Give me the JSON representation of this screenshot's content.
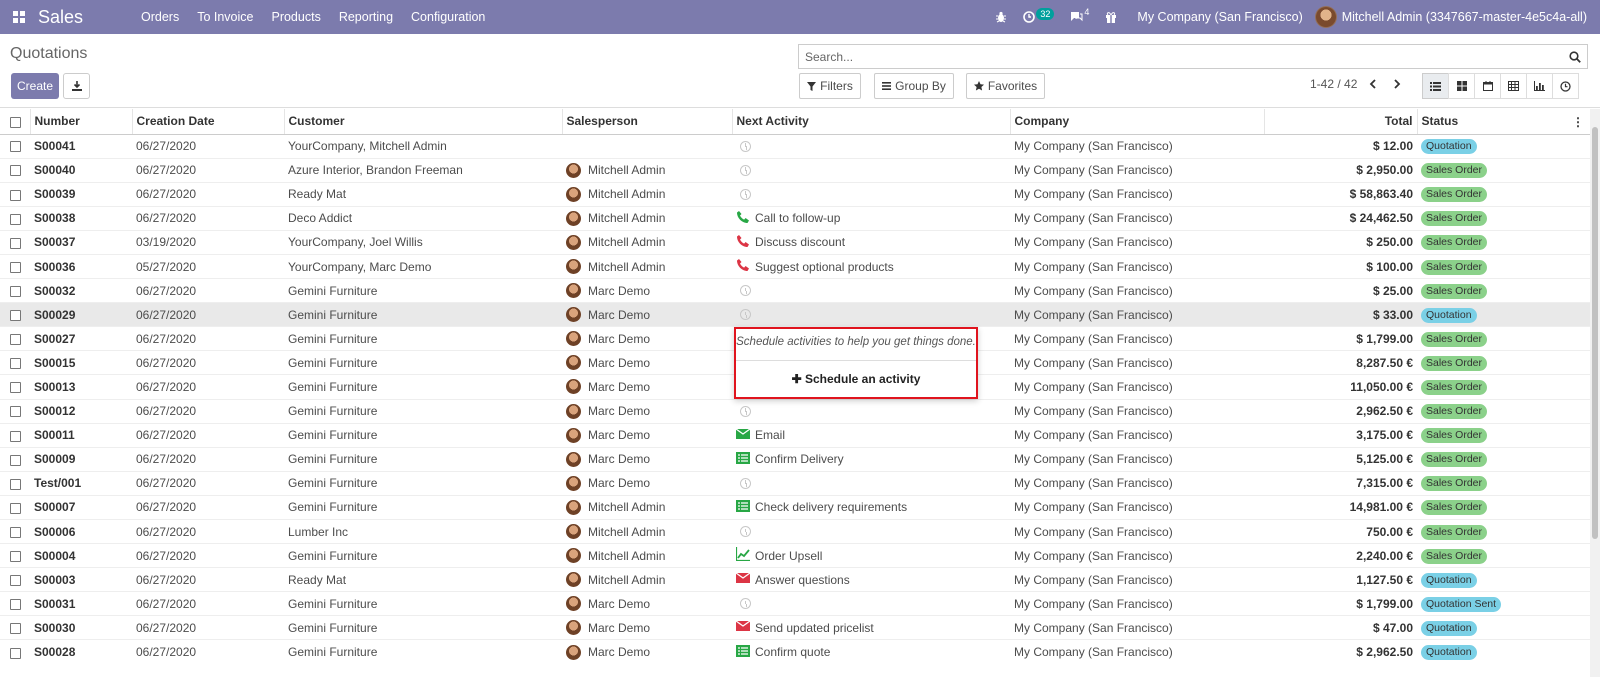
{
  "navbar": {
    "app_name": "Sales",
    "menu": [
      "Orders",
      "To Invoice",
      "Products",
      "Reporting",
      "Configuration"
    ],
    "activity_count": "32",
    "message_count": "4",
    "company": "My Company (San Francisco)",
    "user": "Mitchell Admin (3347667-master-4e5c4a-all)"
  },
  "control_panel": {
    "breadcrumb": "Quotations",
    "create_label": "Create",
    "search_placeholder": "Search...",
    "filters_label": "Filters",
    "group_by_label": "Group By",
    "favorites_label": "Favorites",
    "pager": "1-42 / 42",
    "views": [
      "list-icon",
      "kanban-icon",
      "calendar-icon",
      "pivot-icon",
      "graph-icon",
      "activity-icon"
    ]
  },
  "table": {
    "columns": [
      "Number",
      "Creation Date",
      "Customer",
      "Salesperson",
      "Next Activity",
      "Company",
      "Total",
      "Status"
    ],
    "rows": [
      {
        "number": "S00041",
        "date": "06/27/2020",
        "customer": "YourCompany, Mitchell Admin",
        "salesperson": "",
        "activity": "",
        "activity_icon": "clock",
        "company": "My Company (San Francisco)",
        "total": "$ 12.00",
        "status": "Quotation"
      },
      {
        "number": "S00040",
        "date": "06/27/2020",
        "customer": "Azure Interior, Brandon Freeman",
        "salesperson": "Mitchell Admin",
        "activity": "",
        "activity_icon": "clock",
        "company": "My Company (San Francisco)",
        "total": "$ 2,950.00",
        "status": "Sales Order"
      },
      {
        "number": "S00039",
        "date": "06/27/2020",
        "customer": "Ready Mat",
        "salesperson": "Mitchell Admin",
        "activity": "",
        "activity_icon": "clock",
        "company": "My Company (San Francisco)",
        "total": "$ 58,863.40",
        "status": "Sales Order"
      },
      {
        "number": "S00038",
        "date": "06/27/2020",
        "customer": "Deco Addict",
        "salesperson": "Mitchell Admin",
        "activity": "Call to follow-up",
        "activity_icon": "phone-green",
        "company": "My Company (San Francisco)",
        "total": "$ 24,462.50",
        "status": "Sales Order"
      },
      {
        "number": "S00037",
        "date": "03/19/2020",
        "customer": "YourCompany, Joel Willis",
        "salesperson": "Mitchell Admin",
        "activity": "Discuss discount",
        "activity_icon": "phone-red",
        "company": "My Company (San Francisco)",
        "total": "$ 250.00",
        "status": "Sales Order"
      },
      {
        "number": "S00036",
        "date": "05/27/2020",
        "customer": "YourCompany, Marc Demo",
        "salesperson": "Mitchell Admin",
        "activity": "Suggest optional products",
        "activity_icon": "phone-red",
        "company": "My Company (San Francisco)",
        "total": "$ 100.00",
        "status": "Sales Order"
      },
      {
        "number": "S00032",
        "date": "06/27/2020",
        "customer": "Gemini Furniture",
        "salesperson": "Marc Demo",
        "activity": "",
        "activity_icon": "clock",
        "company": "My Company (San Francisco)",
        "total": "$ 25.00",
        "status": "Sales Order"
      },
      {
        "number": "S00029",
        "date": "06/27/2020",
        "customer": "Gemini Furniture",
        "salesperson": "Marc Demo",
        "activity": "",
        "activity_icon": "clock",
        "company": "My Company (San Francisco)",
        "total": "$ 33.00",
        "status": "Quotation"
      },
      {
        "number": "S00027",
        "date": "06/27/2020",
        "customer": "Gemini Furniture",
        "salesperson": "Marc Demo",
        "activity": "",
        "activity_icon": "none",
        "company": "My Company (San Francisco)",
        "total": "$ 1,799.00",
        "status": "Sales Order"
      },
      {
        "number": "S00015",
        "date": "06/27/2020",
        "customer": "Gemini Furniture",
        "salesperson": "Marc Demo",
        "activity": "",
        "activity_icon": "none",
        "company": "My Company (San Francisco)",
        "total": "8,287.50 €",
        "status": "Sales Order"
      },
      {
        "number": "S00013",
        "date": "06/27/2020",
        "customer": "Gemini Furniture",
        "salesperson": "Marc Demo",
        "activity": "",
        "activity_icon": "none",
        "company": "My Company (San Francisco)",
        "total": "11,050.00 €",
        "status": "Sales Order"
      },
      {
        "number": "S00012",
        "date": "06/27/2020",
        "customer": "Gemini Furniture",
        "salesperson": "Marc Demo",
        "activity": "",
        "activity_icon": "clock",
        "company": "My Company (San Francisco)",
        "total": "2,962.50 €",
        "status": "Sales Order"
      },
      {
        "number": "S00011",
        "date": "06/27/2020",
        "customer": "Gemini Furniture",
        "salesperson": "Marc Demo",
        "activity": "Email",
        "activity_icon": "email-green",
        "company": "My Company (San Francisco)",
        "total": "3,175.00 €",
        "status": "Sales Order"
      },
      {
        "number": "S00009",
        "date": "06/27/2020",
        "customer": "Gemini Furniture",
        "salesperson": "Marc Demo",
        "activity": "Confirm Delivery",
        "activity_icon": "list-green",
        "company": "My Company (San Francisco)",
        "total": "5,125.00 €",
        "status": "Sales Order"
      },
      {
        "number": "Test/001",
        "date": "06/27/2020",
        "customer": "Gemini Furniture",
        "salesperson": "Marc Demo",
        "activity": "",
        "activity_icon": "clock",
        "company": "My Company (San Francisco)",
        "total": "7,315.00 €",
        "status": "Sales Order"
      },
      {
        "number": "S00007",
        "date": "06/27/2020",
        "customer": "Gemini Furniture",
        "salesperson": "Mitchell Admin",
        "activity": "Check delivery requirements",
        "activity_icon": "list-green",
        "company": "My Company (San Francisco)",
        "total": "14,981.00 €",
        "status": "Sales Order"
      },
      {
        "number": "S00006",
        "date": "06/27/2020",
        "customer": "Lumber Inc",
        "salesperson": "Mitchell Admin",
        "activity": "",
        "activity_icon": "clock",
        "company": "My Company (San Francisco)",
        "total": "750.00 €",
        "status": "Sales Order"
      },
      {
        "number": "S00004",
        "date": "06/27/2020",
        "customer": "Gemini Furniture",
        "salesperson": "Mitchell Admin",
        "activity": "Order Upsell",
        "activity_icon": "chart-green",
        "company": "My Company (San Francisco)",
        "total": "2,240.00 €",
        "status": "Sales Order"
      },
      {
        "number": "S00003",
        "date": "06/27/2020",
        "customer": "Ready Mat",
        "salesperson": "Mitchell Admin",
        "activity": "Answer questions",
        "activity_icon": "email-red",
        "company": "My Company (San Francisco)",
        "total": "1,127.50 €",
        "status": "Quotation"
      },
      {
        "number": "S00031",
        "date": "06/27/2020",
        "customer": "Gemini Furniture",
        "salesperson": "Marc Demo",
        "activity": "",
        "activity_icon": "clock",
        "company": "My Company (San Francisco)",
        "total": "$ 1,799.00",
        "status": "Quotation Sent"
      },
      {
        "number": "S00030",
        "date": "06/27/2020",
        "customer": "Gemini Furniture",
        "salesperson": "Marc Demo",
        "activity": "Send updated pricelist",
        "activity_icon": "email-red",
        "company": "My Company (San Francisco)",
        "total": "$ 47.00",
        "status": "Quotation"
      },
      {
        "number": "S00028",
        "date": "06/27/2020",
        "customer": "Gemini Furniture",
        "salesperson": "Marc Demo",
        "activity": "Confirm quote",
        "activity_icon": "list-green",
        "company": "My Company (San Francisco)",
        "total": "$ 2,962.50",
        "status": "Quotation"
      }
    ]
  },
  "popover": {
    "hint": "Schedule activities to help you get things done.",
    "button_label": "Schedule an activity"
  },
  "colors": {
    "navbar": "#7c7bad",
    "status_quotation": "#7ad0e6",
    "status_sales_order": "#8bd18a",
    "activity_green": "#28a745",
    "activity_red": "#dc3545",
    "popover_border": "#e0141e"
  }
}
